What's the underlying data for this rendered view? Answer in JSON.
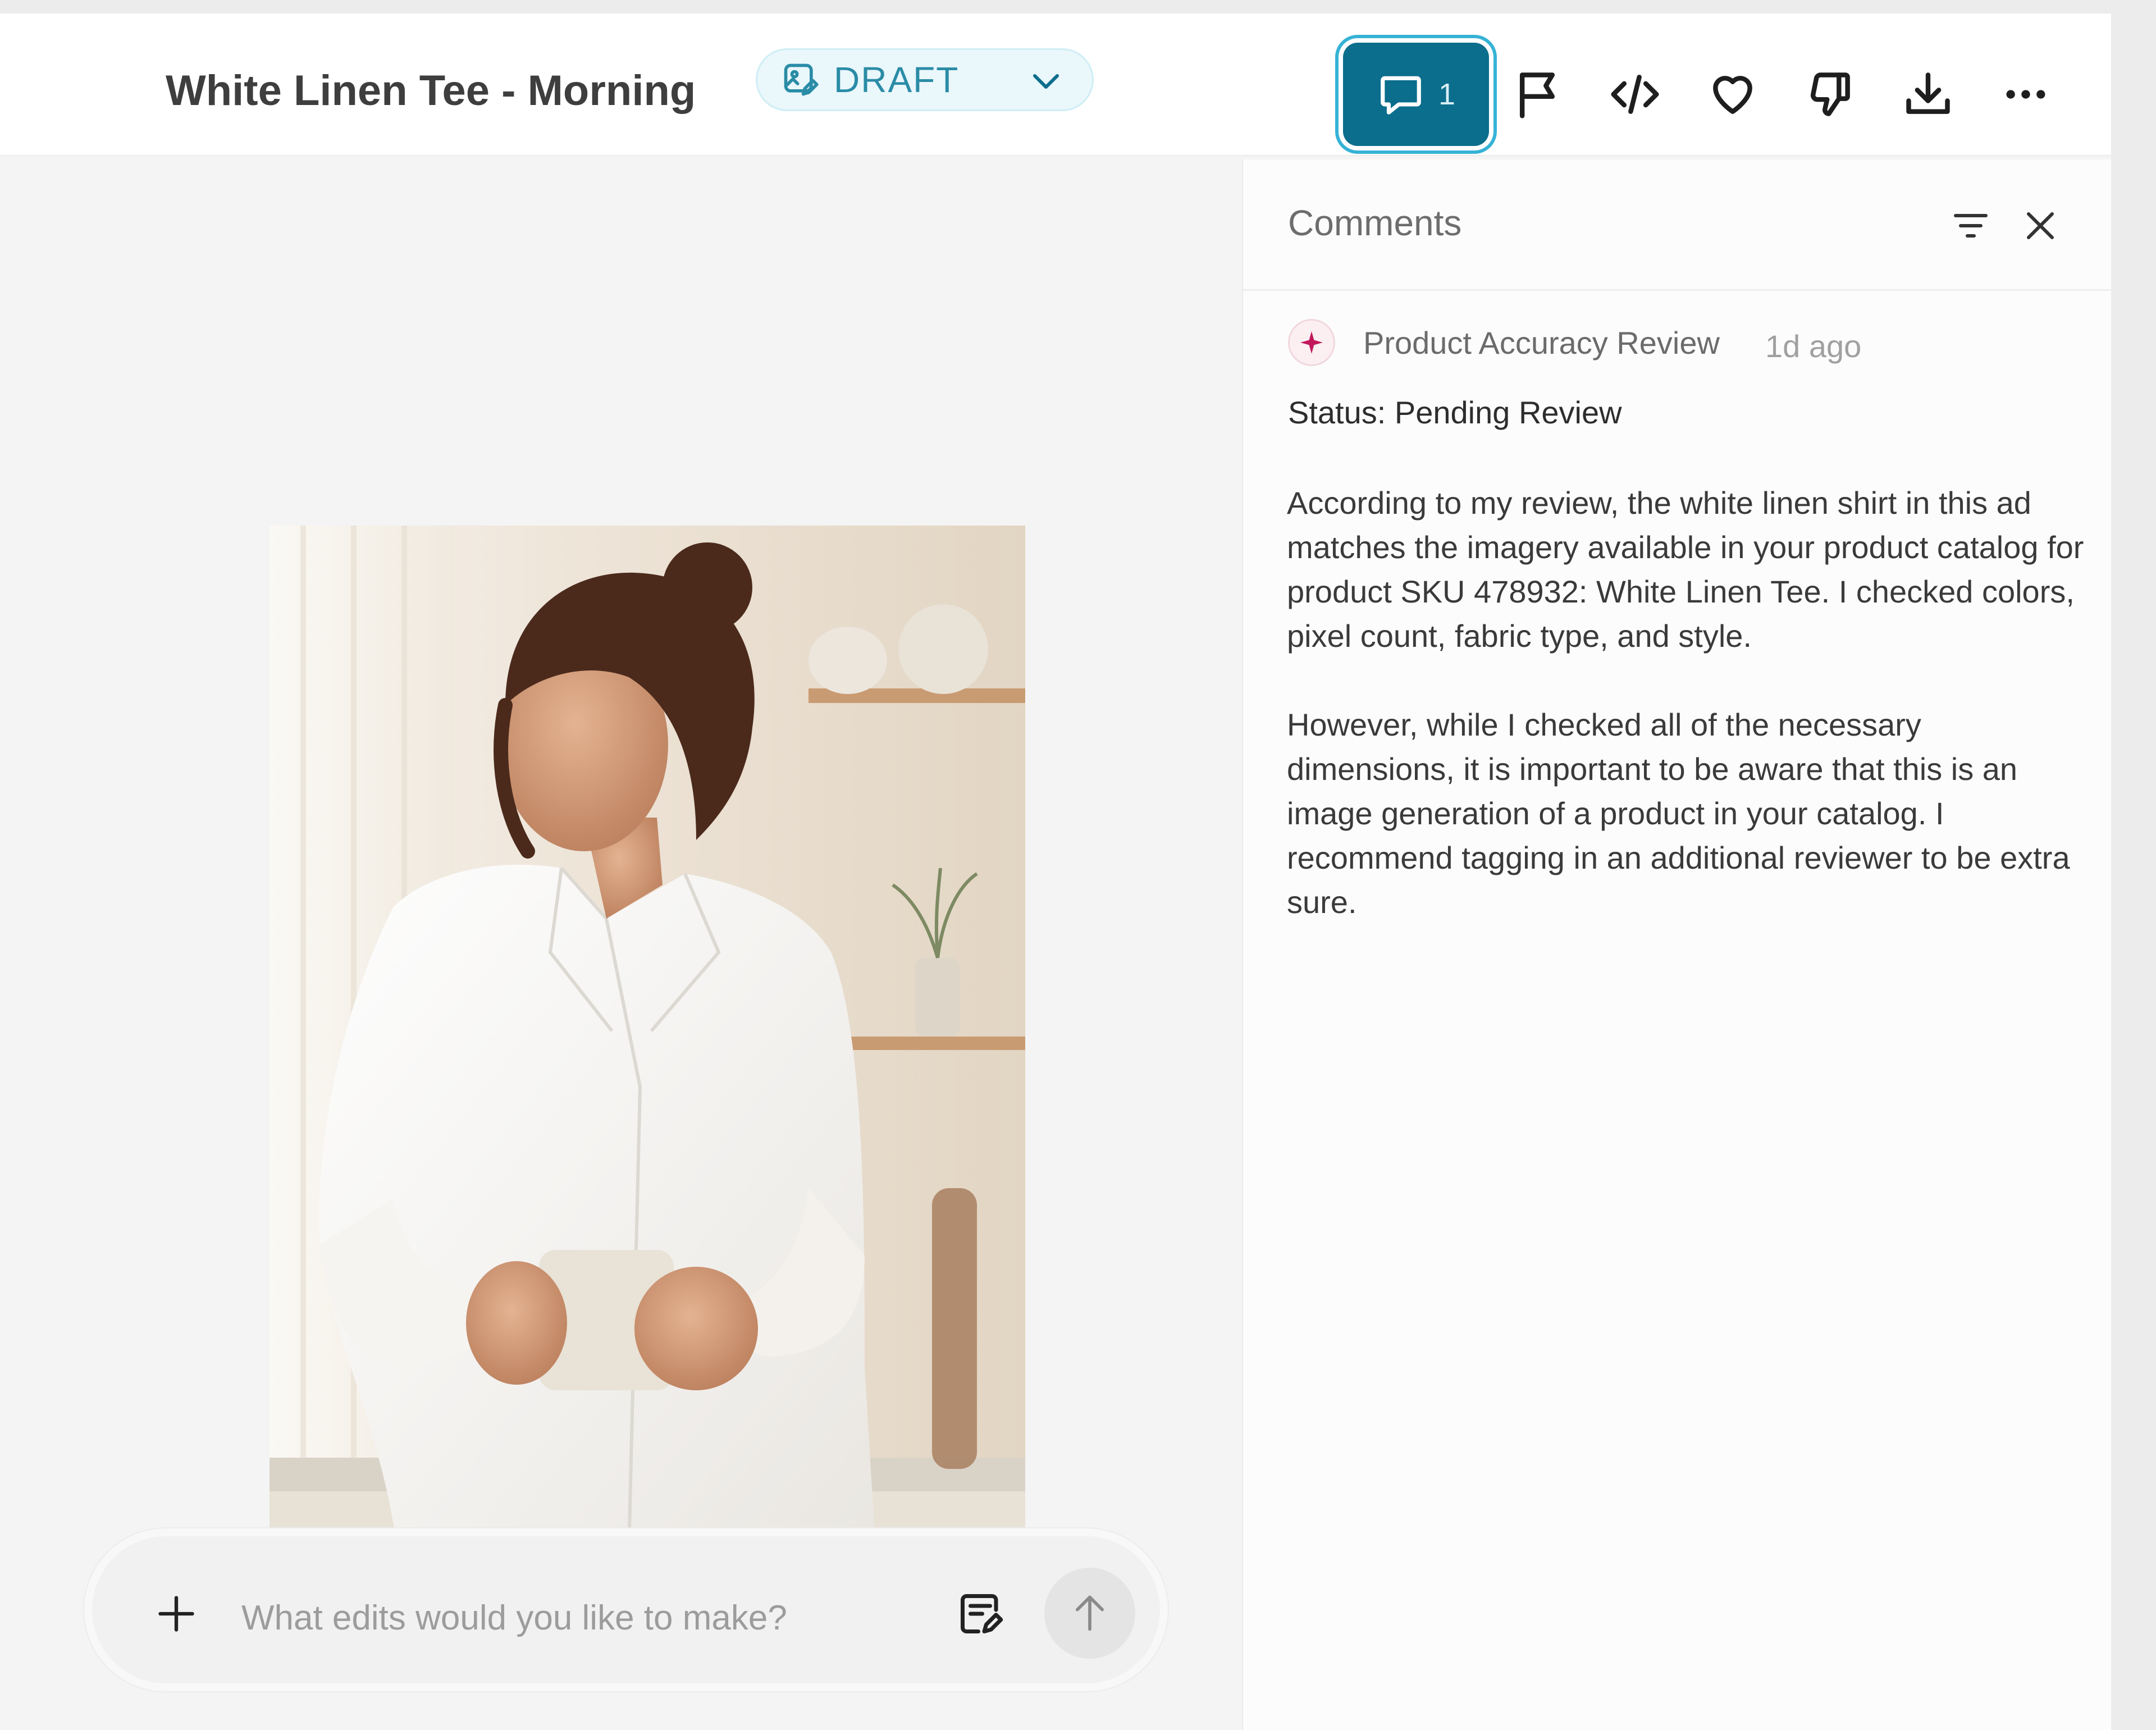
{
  "header": {
    "title": "White Linen Tee - Morning",
    "status": "DRAFT",
    "comments_count": "1",
    "toolbar_icons": [
      "comment-icon",
      "flag-icon",
      "code-icon",
      "heart-icon",
      "thumbs-down-icon",
      "download-icon",
      "more-icon"
    ]
  },
  "colors": {
    "accent": "#0b6e8c",
    "draft_text": "#2a8ca6",
    "draft_bg": "#eaf7fb",
    "avatar_accent": "#c2185b"
  },
  "prompt": {
    "placeholder": "What edits would you like to make?"
  },
  "comments_panel": {
    "title": "Comments",
    "comments": [
      {
        "author": "Product Accuracy Review",
        "time": "1d ago",
        "status": "Status: Pending Review",
        "paragraphs": [
          "According to my review, the white linen shirt in this ad matches the imagery available in your product catalog for product SKU 478932: White Linen Tee. I checked colors, pixel count, fabric type, and style.",
          "However, while I checked all of the necessary dimensions, it is important to be aware that this is an image generation of a product in your catalog. I recommend tagging in an additional reviewer to be extra sure."
        ]
      }
    ]
  }
}
